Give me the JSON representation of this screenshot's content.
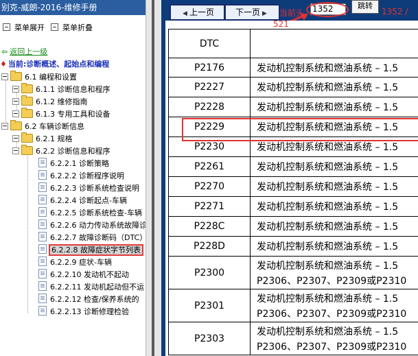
{
  "left": {
    "title": "别克-威朗-2016-维修手册",
    "expand_all": "菜单展开",
    "collapse_all": "菜单折叠",
    "back_link": "返回上一级",
    "current_prefix": "当前:",
    "current_title": "诊断概述、起始点和编程",
    "tree": [
      {
        "label": "6.1 编程和设置",
        "kind": "folder-expanded"
      },
      {
        "label": "6.1.1 诊断信息和程序",
        "kind": "folder"
      },
      {
        "label": "6.1.2 维修指南",
        "kind": "folder"
      },
      {
        "label": "6.1.3 专用工具和设备",
        "kind": "folder"
      },
      {
        "label": "6.2 车辆诊断信息",
        "kind": "folder-expanded"
      },
      {
        "label": "6.2.1 规格",
        "kind": "folder"
      },
      {
        "label": "6.2.2 诊断信息和程序",
        "kind": "folder-expanded"
      },
      {
        "label": "6.2.2.1 诊断策略",
        "kind": "doc"
      },
      {
        "label": "6.2.2.2 诊断程序说明",
        "kind": "doc"
      },
      {
        "label": "6.2.2.3 诊断系统检查说明",
        "kind": "doc"
      },
      {
        "label": "6.2.2.4 诊断起点-车辆",
        "kind": "doc"
      },
      {
        "label": "6.2.2.5 诊断系统检查-车辆",
        "kind": "doc"
      },
      {
        "label": "6.2.2.6 动力传动系统故障诊",
        "kind": "doc"
      },
      {
        "label": "6.2.2.7 故障诊断码（DTC）",
        "kind": "doc"
      },
      {
        "label": "6.2.2.8 故障症状字节列表",
        "kind": "doc-selected"
      },
      {
        "label": "6.2.2.9 症状-车辆",
        "kind": "doc"
      },
      {
        "label": "6.2.2.10 发动机不起动",
        "kind": "doc"
      },
      {
        "label": "6.2.2.11 发动机起动但不运",
        "kind": "doc"
      },
      {
        "label": "6.2.2.12 检查/保养系统的",
        "kind": "doc"
      },
      {
        "label": "6.2.2.13 诊断修理检验",
        "kind": "doc"
      }
    ]
  },
  "nav": {
    "prev_label": "上一页",
    "next_label": "下一页",
    "current_label": "当前头",
    "page_value": "1352",
    "jump_label": "跳转",
    "total_label": "1352 /",
    "total_wrap": "521"
  },
  "table": {
    "header": "DTC",
    "rows": [
      {
        "dtc": "P2176",
        "desc": [
          "发动机控制系统和燃油系统 – 1.5"
        ]
      },
      {
        "dtc": "P2227",
        "desc": [
          "发动机控制系统和燃油系统 – 1.5"
        ]
      },
      {
        "dtc": "P2228",
        "desc": [
          "发动机控制系统和燃油系统 – 1.5"
        ]
      },
      {
        "dtc": "P2229",
        "desc": [
          "发动机控制系统和燃油系统 – 1.5"
        ]
      },
      {
        "dtc": "P2230",
        "desc": [
          "发动机控制系统和燃油系统 – 1.5"
        ]
      },
      {
        "dtc": "P2261",
        "desc": [
          "发动机控制系统和燃油系统 – 1.5"
        ]
      },
      {
        "dtc": "P2270",
        "desc": [
          "发动机控制系统和燃油系统 – 1.5"
        ]
      },
      {
        "dtc": "P2271",
        "desc": [
          "发动机控制系统和燃油系统 – 1.5"
        ]
      },
      {
        "dtc": "P228C",
        "desc": [
          "发动机控制系统和燃油系统 – 1.5"
        ]
      },
      {
        "dtc": "P228D",
        "desc": [
          "发动机控制系统和燃油系统 – 1.5"
        ]
      },
      {
        "dtc": "P2300",
        "desc": [
          "发动机控制系统和燃油系统 – 1.5",
          "P2306、P2307、P2309或P2310"
        ]
      },
      {
        "dtc": "P2301",
        "desc": [
          "发动机控制系统和燃油系统 – 1.5",
          "P2306、P2307、P2309或P2310"
        ]
      },
      {
        "dtc": "P2303",
        "desc": [
          "发动机控制系统和燃油系统 – 1.5",
          "P2306、P2307、P2309或P2310"
        ]
      }
    ]
  },
  "colors": {
    "title_bar": "#2a5ea0",
    "right_bg": "#0e3c7a",
    "highlight": "#e43030",
    "tree_current": "#1a2fb8"
  }
}
